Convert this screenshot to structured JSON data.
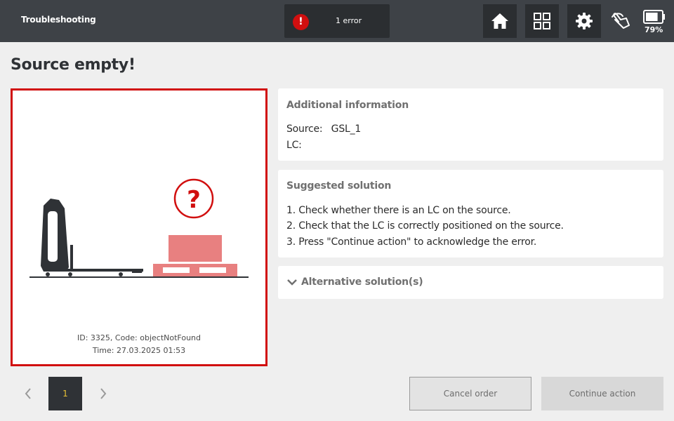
{
  "header": {
    "title": "Troubleshooting",
    "error_indicator": {
      "icon": "exclamation-icon",
      "text": "1 error",
      "color": "#d10f0f"
    },
    "buttons": [
      "home-icon",
      "grid-icon",
      "gear-icon"
    ],
    "manual_icon": "hand-pointer-icon",
    "battery": {
      "icon": "battery-icon",
      "percent": "79%",
      "level": 0.79
    }
  },
  "page": {
    "title": "Source empty!"
  },
  "illustration": {
    "id_code": "ID: 3325, Code: objectNotFound",
    "time": "Time: 27.03.2025 01:53",
    "accent": "#d10f0f",
    "object_color": "#e88080"
  },
  "additional_info": {
    "heading": "Additional information",
    "source_label": "Source:",
    "source_value": "GSL_1",
    "lc_label": "LC:",
    "lc_value": ""
  },
  "suggested_solution": {
    "heading": "Suggested solution",
    "steps": [
      "1. Check whether there is an LC on the source.",
      "2. Check that the LC is correctly positioned on the source.",
      "3. Press \"Continue action\" to acknowledge the error."
    ]
  },
  "alternative": {
    "label": "Alternative solution(s)",
    "icon": "chevron-down-icon"
  },
  "pagination": {
    "current": "1",
    "prev_icon": "chevron-left-icon",
    "next_icon": "chevron-right-icon"
  },
  "actions": {
    "cancel": "Cancel order",
    "continue": "Continue action"
  }
}
